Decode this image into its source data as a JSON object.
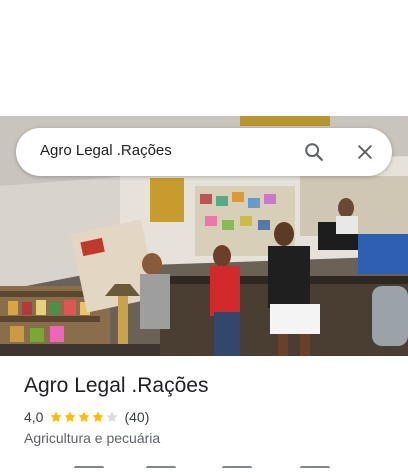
{
  "search": {
    "query": "Agro Legal .Rações"
  },
  "place": {
    "name": "Agro Legal .Rações",
    "rating": "4,0",
    "rating_value": 4.0,
    "max_stars": 5,
    "review_count": "(40)",
    "category": "Agricultura e pecuária"
  },
  "photo": {
    "description_icon": "storefront-photo"
  },
  "colors": {
    "star_filled": "#fbbc04",
    "star_empty": "#dadce0",
    "icon": "#5f6368"
  }
}
